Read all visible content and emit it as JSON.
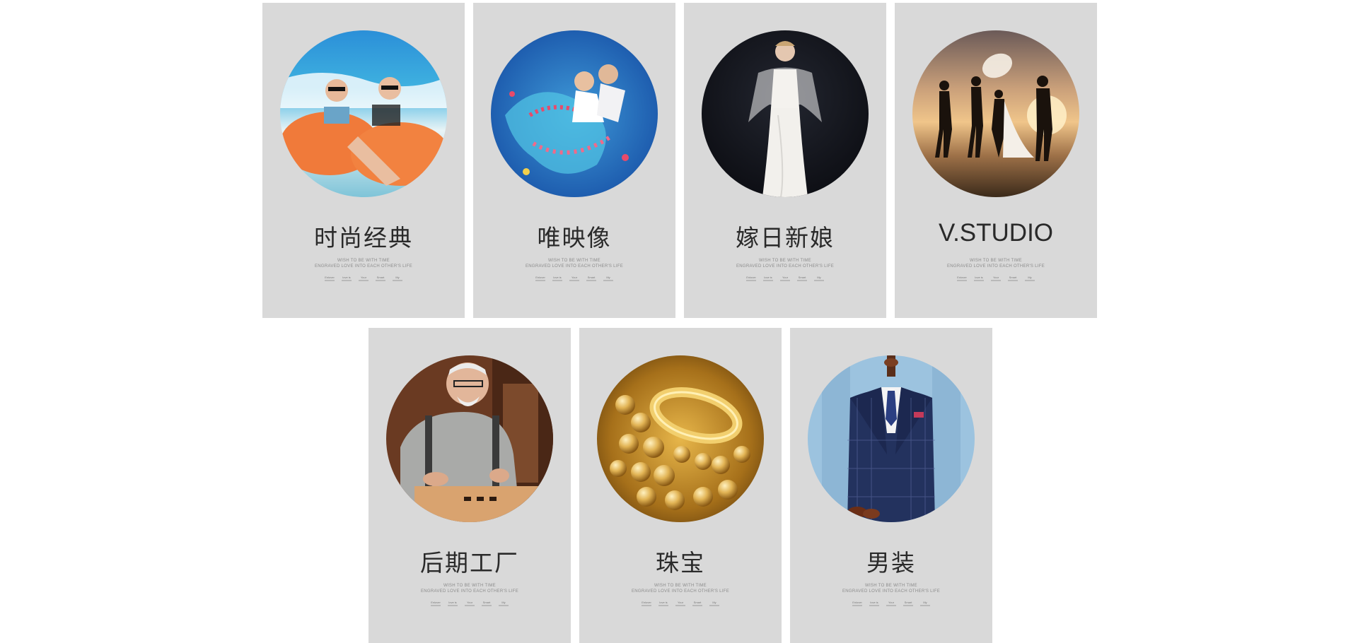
{
  "cards": [
    {
      "title": "时尚经典",
      "sub1": "WISH TO BE WITH TIME",
      "sub2": "ENGRAVED LOVE INTO EACH OTHER'S LIFE",
      "meta": [
        "Enlover",
        "love is",
        "Your",
        "Smart",
        "My"
      ],
      "icon": "beach-couple-photo"
    },
    {
      "title": "唯映像",
      "sub1": "WISH TO BE WITH TIME",
      "sub2": "ENGRAVED LOVE INTO EACH OTHER'S LIFE",
      "meta": [
        "Enlover",
        "love is",
        "Your",
        "Smart",
        "My"
      ],
      "icon": "underwater-couple-photo"
    },
    {
      "title": "嫁日新娘",
      "sub1": "WISH TO BE WITH TIME",
      "sub2": "ENGRAVED LOVE INTO EACH OTHER'S LIFE",
      "meta": [
        "Enlover",
        "love is",
        "Your",
        "Smart",
        "My"
      ],
      "icon": "bride-dress-photo"
    },
    {
      "title": "V.STUDIO",
      "sub1": "WISH TO BE WITH TIME",
      "sub2": "ENGRAVED LOVE INTO EACH OTHER'S LIFE",
      "meta": [
        "Enlover",
        "love is",
        "Your",
        "Smart",
        "My"
      ],
      "icon": "studio-sunset-photo"
    },
    {
      "title": "后期工厂",
      "sub1": "WISH TO BE WITH TIME",
      "sub2": "ENGRAVED LOVE INTO EACH OTHER'S LIFE",
      "meta": [
        "Enlover",
        "love is",
        "Your",
        "Smart",
        "My"
      ],
      "icon": "craftsman-photo"
    },
    {
      "title": "珠宝",
      "sub1": "WISH TO BE WITH TIME",
      "sub2": "ENGRAVED LOVE INTO EACH OTHER'S LIFE",
      "meta": [
        "Enlover",
        "love is",
        "Your",
        "Smart",
        "My"
      ],
      "icon": "gold-jewelry-photo"
    },
    {
      "title": "男装",
      "sub1": "WISH TO BE WITH TIME",
      "sub2": "ENGRAVED LOVE INTO EACH OTHER'S LIFE",
      "meta": [
        "Enlover",
        "love is",
        "Your",
        "Smart",
        "My"
      ],
      "icon": "menswear-suit-photo"
    }
  ],
  "colors": {
    "card_bg": "#d9d9d9",
    "title": "#2a2a2a",
    "subtitle": "#8c8c8c"
  }
}
